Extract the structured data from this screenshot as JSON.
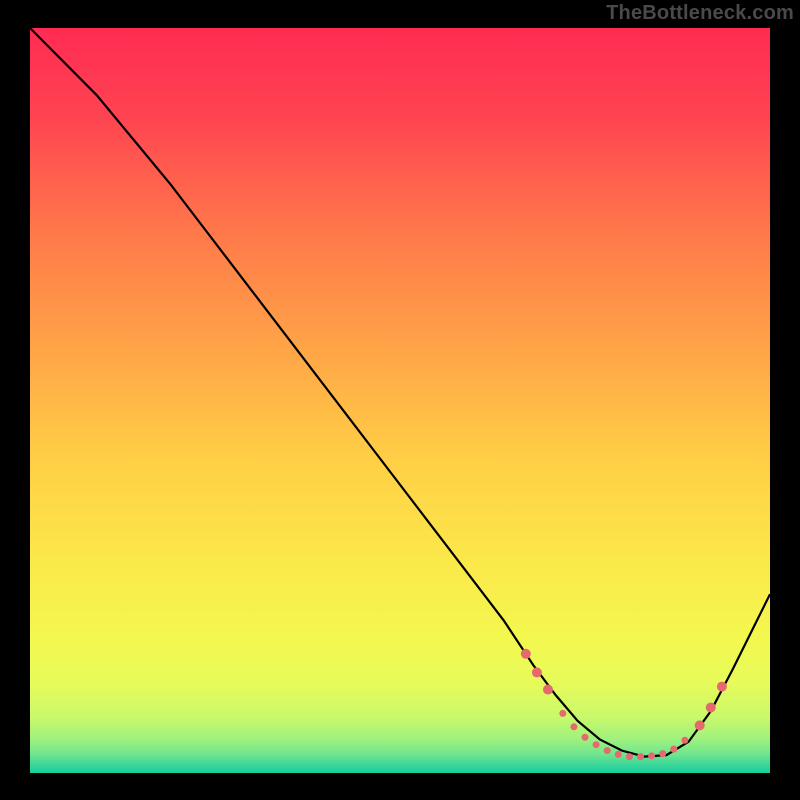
{
  "watermark": "TheBottleneck.com",
  "colors": {
    "frame": "#000000",
    "curve": "#000000",
    "marker": "#e46a6d",
    "gradient_stops": [
      {
        "offset": 0.0,
        "color": "#ff2b52"
      },
      {
        "offset": 0.12,
        "color": "#ff4451"
      },
      {
        "offset": 0.28,
        "color": "#ff7a4a"
      },
      {
        "offset": 0.44,
        "color": "#ffa747"
      },
      {
        "offset": 0.58,
        "color": "#ffcf46"
      },
      {
        "offset": 0.72,
        "color": "#fbe94a"
      },
      {
        "offset": 0.82,
        "color": "#f3f84f"
      },
      {
        "offset": 0.88,
        "color": "#e6fb5a"
      },
      {
        "offset": 0.925,
        "color": "#c9f96a"
      },
      {
        "offset": 0.955,
        "color": "#9ef17e"
      },
      {
        "offset": 0.975,
        "color": "#6fe58e"
      },
      {
        "offset": 0.99,
        "color": "#37d59a"
      },
      {
        "offset": 1.0,
        "color": "#18cd9f"
      }
    ]
  },
  "chart_data": {
    "type": "line",
    "title": "",
    "xlabel": "",
    "ylabel": "",
    "xlim": [
      0,
      100
    ],
    "ylim": [
      0,
      100
    ],
    "grid": false,
    "legend": false,
    "series": [
      {
        "name": "bottleneck-curve",
        "x": [
          0,
          4,
          9,
          14,
          19,
          24,
          29,
          34,
          39,
          44,
          49,
          54,
          59,
          64,
          68,
          71,
          74,
          77,
          80,
          83,
          86,
          89,
          92,
          95,
          98,
          100
        ],
        "y": [
          100,
          96,
          91,
          85,
          79,
          72.5,
          66,
          59.5,
          53,
          46.5,
          40,
          33.5,
          27,
          20.5,
          14.5,
          10.5,
          7,
          4.5,
          3,
          2.2,
          2.4,
          4.2,
          8.3,
          14,
          20,
          24
        ]
      }
    ],
    "markers": {
      "series": "bottleneck-curve",
      "color_key": "marker",
      "radius_big": 5.0,
      "radius_small": 3.5,
      "points": [
        {
          "x": 67.0,
          "y": 16.0,
          "r": "big"
        },
        {
          "x": 68.5,
          "y": 13.5,
          "r": "big"
        },
        {
          "x": 70.0,
          "y": 11.2,
          "r": "big"
        },
        {
          "x": 72.0,
          "y": 8.0,
          "r": "small"
        },
        {
          "x": 73.5,
          "y": 6.2,
          "r": "small"
        },
        {
          "x": 75.0,
          "y": 4.8,
          "r": "small"
        },
        {
          "x": 76.5,
          "y": 3.8,
          "r": "small"
        },
        {
          "x": 78.0,
          "y": 3.0,
          "r": "small"
        },
        {
          "x": 79.5,
          "y": 2.5,
          "r": "small"
        },
        {
          "x": 81.0,
          "y": 2.2,
          "r": "small"
        },
        {
          "x": 82.5,
          "y": 2.2,
          "r": "small"
        },
        {
          "x": 84.0,
          "y": 2.3,
          "r": "small"
        },
        {
          "x": 85.5,
          "y": 2.6,
          "r": "small"
        },
        {
          "x": 87.0,
          "y": 3.2,
          "r": "small"
        },
        {
          "x": 88.5,
          "y": 4.4,
          "r": "small"
        },
        {
          "x": 90.5,
          "y": 6.4,
          "r": "big"
        },
        {
          "x": 92.0,
          "y": 8.8,
          "r": "big"
        },
        {
          "x": 93.5,
          "y": 11.6,
          "r": "big"
        }
      ]
    }
  }
}
